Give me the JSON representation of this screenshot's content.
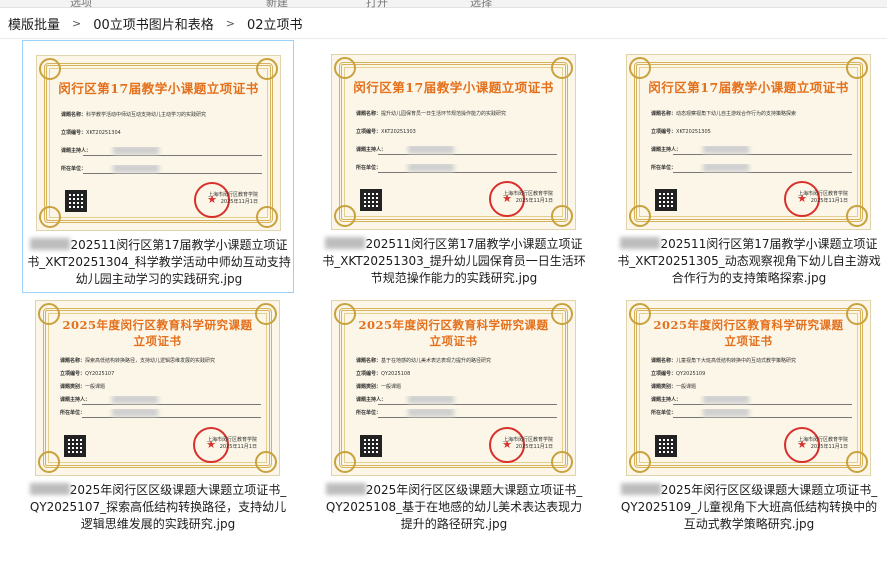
{
  "ribbon": {
    "tabs": [
      "选项",
      "新建",
      "打开",
      "选择"
    ]
  },
  "breadcrumb": [
    "模版批量",
    "00立项书图片和表格",
    "02立项书"
  ],
  "files": [
    {
      "name": "202511闵行区第17届教学小课题立项证书_XKT20251304_科学教学活动中师幼互动支持幼儿园主动学习的实践研究.jpg",
      "selected": true,
      "cert": {
        "style": "t1",
        "title": "闵行区第17届教学小课题立项证书",
        "project_label": "课题名称：",
        "project": "科学教学活动中师幼互动支持幼儿主动学习的实践研究",
        "id_label": "立项编号：",
        "id": "XKT20251304",
        "host_label": "课题主持人：",
        "unit_label": "所在单位：",
        "issuer": "上海市闵行区教育学院",
        "date": "2025年11月1日"
      }
    },
    {
      "name": "202511闵行区第17届教学小课题立项证书_XKT20251303_提升幼儿园保育员一日生活环节规范操作能力的实践研究.jpg",
      "selected": false,
      "cert": {
        "style": "t1",
        "title": "闵行区第17届教学小课题立项证书",
        "project_label": "课题名称：",
        "project": "提升幼儿园保育员一日生活环节规范操作能力的实践研究",
        "id_label": "立项编号：",
        "id": "XKT20251303",
        "host_label": "课题主持人：",
        "unit_label": "所在单位：",
        "issuer": "上海市闵行区教育学院",
        "date": "2025年11月1日"
      }
    },
    {
      "name": "202511闵行区第17届教学小课题立项证书_XKT20251305_动态观察视角下幼儿自主游戏合作行为的支持策略探索.jpg",
      "selected": false,
      "cert": {
        "style": "t1",
        "title": "闵行区第17届教学小课题立项证书",
        "project_label": "课题名称：",
        "project": "动态观察视角下幼儿自主游戏合作行为的支持策略探索",
        "id_label": "立项编号：",
        "id": "XKT20251305",
        "host_label": "课题主持人：",
        "unit_label": "所在单位：",
        "issuer": "上海市闵行区教育学院",
        "date": "2025年11月1日"
      }
    },
    {
      "name": "2025年闵行区区级课题大课题立项证书_QY2025107_探索高低结构转换路径，支持幼儿逻辑思维发展的实践研究.jpg",
      "selected": false,
      "cert": {
        "style": "t2",
        "title_a": "2025年度闵行区教育科学研究课题",
        "title_b": "立项证书",
        "project_label": "课题名称：",
        "project": "探索高低结构转换路径，支持幼儿逻辑思维发展的实践研究",
        "id_label": "立项编号：",
        "id": "QY2025107",
        "type_label": "课题类别：",
        "type": "一般课题",
        "host_label": "课题主持人：",
        "unit_label": "所在单位：",
        "issuer": "上海市闵行区教育学院",
        "date": "2025年11月1日"
      }
    },
    {
      "name": "2025年闵行区区级课题大课题立项证书_QY2025108_基于在地感的幼儿美术表达表现力提升的路径研究.jpg",
      "selected": false,
      "cert": {
        "style": "t2",
        "title_a": "2025年度闵行区教育科学研究课题",
        "title_b": "立项证书",
        "project_label": "课题名称：",
        "project": "基于在地感的幼儿美术表达表现力提升的路径研究",
        "id_label": "立项编号：",
        "id": "QY2025108",
        "type_label": "课题类别：",
        "type": "一般课题",
        "host_label": "课题主持人：",
        "unit_label": "所在单位：",
        "issuer": "上海市闵行区教育学院",
        "date": "2025年11月1日"
      }
    },
    {
      "name": "2025年闵行区区级课题大课题立项证书_QY2025109_儿童视角下大班高低结构转换中的互动式教学策略研究.jpg",
      "selected": false,
      "cert": {
        "style": "t2",
        "title_a": "2025年度闵行区教育科学研究课题",
        "title_b": "立项证书",
        "project_label": "课题名称：",
        "project": "儿童视角下大班高低结构转换中的互动式教学策略研究",
        "id_label": "立项编号：",
        "id": "QY2025109",
        "type_label": "课题类别：",
        "type": "一般课题",
        "host_label": "课题主持人：",
        "unit_label": "所在单位：",
        "issuer": "上海市闵行区教育学院",
        "date": "2025年11月1日"
      }
    }
  ]
}
